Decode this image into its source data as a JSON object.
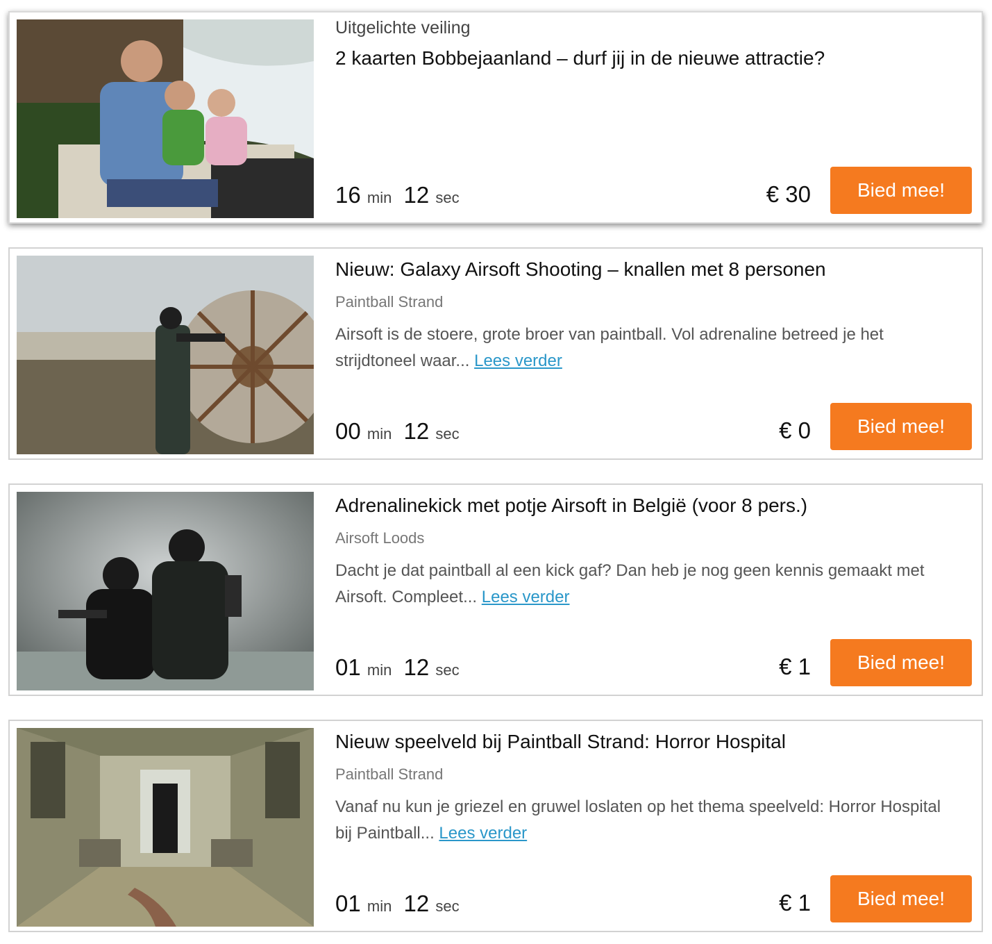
{
  "auctions": [
    {
      "featured_label": "Uitgelichte veiling",
      "title": "2 kaarten Bobbejaanland – durf jij in de nieuwe attractie?",
      "minutes": "16",
      "seconds": "12",
      "min_unit": "min",
      "sec_unit": "sec",
      "price": "€ 30",
      "bid_label": "Bied mee!"
    },
    {
      "title": "Nieuw: Galaxy Airsoft Shooting – knallen met 8 personen",
      "provider": "Paintball Strand",
      "description": "Airsoft is de stoere, grote broer van paintball. Vol adrenaline betreed je het strijdtoneel waar...",
      "read_more": "Lees verder",
      "minutes": "00",
      "seconds": "12",
      "min_unit": "min",
      "sec_unit": "sec",
      "price": "€ 0",
      "bid_label": "Bied mee!"
    },
    {
      "title": "Adrenalinekick met potje Airsoft in België (voor 8 pers.)",
      "provider": "Airsoft Loods",
      "description": "Dacht je dat paintball al een kick gaf? Dan heb je nog geen kennis gemaakt met Airsoft. Compleet...",
      "read_more": "Lees verder",
      "minutes": "01",
      "seconds": "12",
      "min_unit": "min",
      "sec_unit": "sec",
      "price": "€ 1",
      "bid_label": "Bied mee!"
    },
    {
      "title": "Nieuw speelveld bij Paintball Strand: Horror Hospital",
      "provider": "Paintball Strand",
      "description": "Vanaf nu kun je griezel en gruwel loslaten op het thema speelveld: Horror Hospital bij Paintball...",
      "read_more": "Lees verder",
      "minutes": "01",
      "seconds": "12",
      "min_unit": "min",
      "sec_unit": "sec",
      "price": "€ 1",
      "bid_label": "Bied mee!"
    }
  ],
  "colors": {
    "accent": "#f57a1f",
    "link": "#2a97c9"
  }
}
